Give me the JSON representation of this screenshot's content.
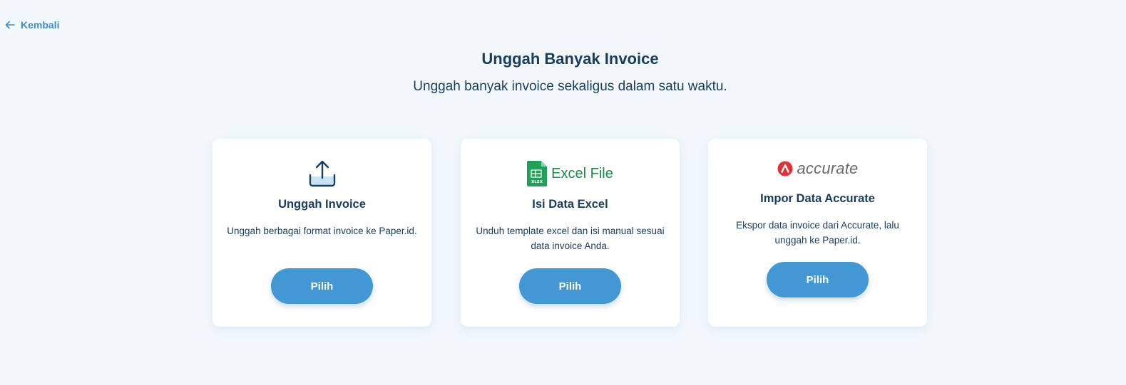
{
  "nav": {
    "back_label": "Kembali"
  },
  "header": {
    "title": "Unggah Banyak Invoice",
    "subtitle": "Unggah banyak invoice sekaligus dalam satu waktu."
  },
  "cards": [
    {
      "icon": "upload-tray-icon",
      "title": "Unggah Invoice",
      "description": "Unggah berbagai format invoice ke Paper.id.",
      "button_label": "Pilih"
    },
    {
      "icon": "excel-file-icon",
      "logo_text": "Excel File",
      "logo_badge": "XLSX",
      "title": "Isi Data Excel",
      "description": "Unduh template excel dan isi manual sesuai data invoice Anda.",
      "button_label": "Pilih"
    },
    {
      "icon": "accurate-logo-icon",
      "logo_text": "accurate",
      "title": "Impor Data Accurate",
      "description": "Ekspor data invoice dari Accurate, lalu unggah ke Paper.id.",
      "button_label": "Pilih"
    }
  ],
  "colors": {
    "background": "#f2f8fc",
    "primary": "#4298d5",
    "text": "#183d5e",
    "link": "#3e8fc9",
    "excel_green": "#1f8a4c",
    "accurate_red": "#e0303a"
  }
}
